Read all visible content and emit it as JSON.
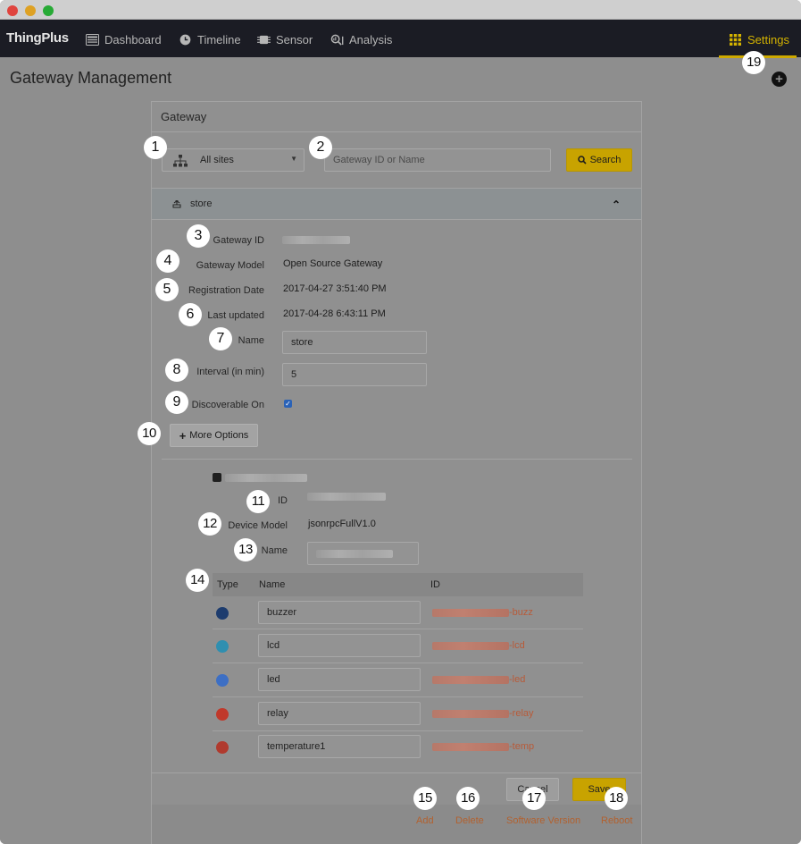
{
  "window": {
    "controls": [
      "close",
      "minimize",
      "maximize"
    ]
  },
  "nav": {
    "brand": "ThingPlus",
    "items": [
      {
        "label": "Dashboard",
        "icon": "dashboard-icon"
      },
      {
        "label": "Timeline",
        "icon": "clock-icon"
      },
      {
        "label": "Sensor",
        "icon": "chip-icon"
      },
      {
        "label": "Analysis",
        "icon": "analysis-icon"
      }
    ],
    "settings_label": "Settings",
    "accent_color": "#cda800"
  },
  "page": {
    "title": "Gateway Management"
  },
  "gateway_panel": {
    "title": "Gateway",
    "site_select_value": "All sites",
    "search_placeholder": "Gateway ID or Name",
    "search_button": "Search"
  },
  "gateway": {
    "name": "store",
    "labels": {
      "gateway_id": "Gateway ID",
      "gateway_model": "Gateway Model",
      "registration_date": "Registration Date",
      "last_updated": "Last updated",
      "name": "Name",
      "interval": "Interval (in min)",
      "discoverable": "Discoverable On"
    },
    "gateway_model": "Open Source Gateway",
    "registration_date": "2017-04-27 3:51:40 PM",
    "last_updated": "2017-04-28 6:43:11 PM",
    "name_value": "store",
    "interval_value": "5",
    "discoverable": true,
    "more_options": "More Options"
  },
  "device": {
    "labels": {
      "id": "ID",
      "model": "Device Model",
      "name": "Name"
    },
    "model": "jsonrpcFullV1.0"
  },
  "sensors": {
    "headers": {
      "type": "Type",
      "name": "Name",
      "id": "ID"
    },
    "rows": [
      {
        "icon": "buzzer-icon",
        "color": "#1d3c6e",
        "name": "buzzer",
        "id_suffix": "-buzz"
      },
      {
        "icon": "lcd-icon",
        "color": "#2f8fb0",
        "name": "lcd",
        "id_suffix": "-lcd"
      },
      {
        "icon": "led-icon",
        "color": "#3d6fc4",
        "name": "led",
        "id_suffix": "-led"
      },
      {
        "icon": "relay-icon",
        "color": "#c0392b",
        "name": "relay",
        "id_suffix": "-relay"
      },
      {
        "icon": "temperature-icon",
        "color": "#b03a2e",
        "name": "temperature1",
        "id_suffix": "-temp"
      }
    ]
  },
  "footer": {
    "cancel": "Cancel",
    "save": "Save",
    "actions": {
      "add": "Add",
      "delete": "Delete",
      "software_version": "Software Version",
      "reboot": "Reboot"
    }
  },
  "markers": [
    "1",
    "2",
    "3",
    "4",
    "5",
    "6",
    "7",
    "8",
    "9",
    "10",
    "11",
    "12",
    "13",
    "14",
    "15",
    "16",
    "17",
    "18",
    "19"
  ]
}
